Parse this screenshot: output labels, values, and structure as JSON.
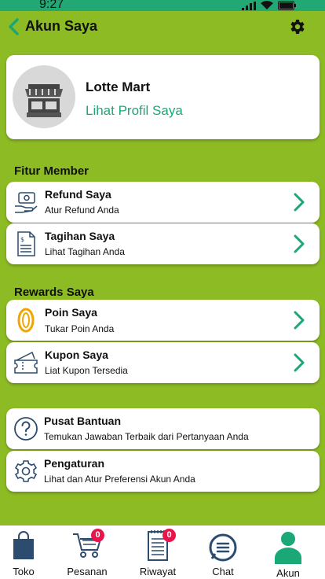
{
  "status": {
    "time": "9:27"
  },
  "header": {
    "title": "Akun Saya"
  },
  "profile": {
    "name": "Lotte Mart",
    "link": "Lihat Profil Saya"
  },
  "sections": {
    "member": "Fitur Member",
    "rewards": "Rewards Saya"
  },
  "member_items": [
    {
      "title": "Refund Saya",
      "subtitle": "Atur Refund Anda",
      "icon": "refund-icon"
    },
    {
      "title": "Tagihan Saya",
      "subtitle": "Lihat Tagihan Anda",
      "icon": "invoice-icon"
    }
  ],
  "reward_items": [
    {
      "title": "Poin Saya",
      "subtitle": "Tukar Poin Anda",
      "icon": "coin-icon"
    },
    {
      "title": "Kupon Saya",
      "subtitle": "Liat Kupon Tersedia",
      "icon": "coupon-icon"
    }
  ],
  "other_items": [
    {
      "title": "Pusat Bantuan",
      "subtitle": "Temukan Jawaban Terbaik dari Pertanyaan Anda",
      "icon": "help-icon"
    },
    {
      "title": "Pengaturan",
      "subtitle": "Lihat dan Atur Preferensi Akun Anda",
      "icon": "settings-icon"
    }
  ],
  "nav": {
    "toko": "Toko",
    "pesanan": "Pesanan",
    "pesanan_badge": "0",
    "riwayat": "Riwayat",
    "riwayat_badge": "0",
    "chat": "Chat",
    "akun": "Akun"
  },
  "colors": {
    "background": "#8dbb24",
    "accent": "#1aa877",
    "badge": "#e8144a"
  }
}
